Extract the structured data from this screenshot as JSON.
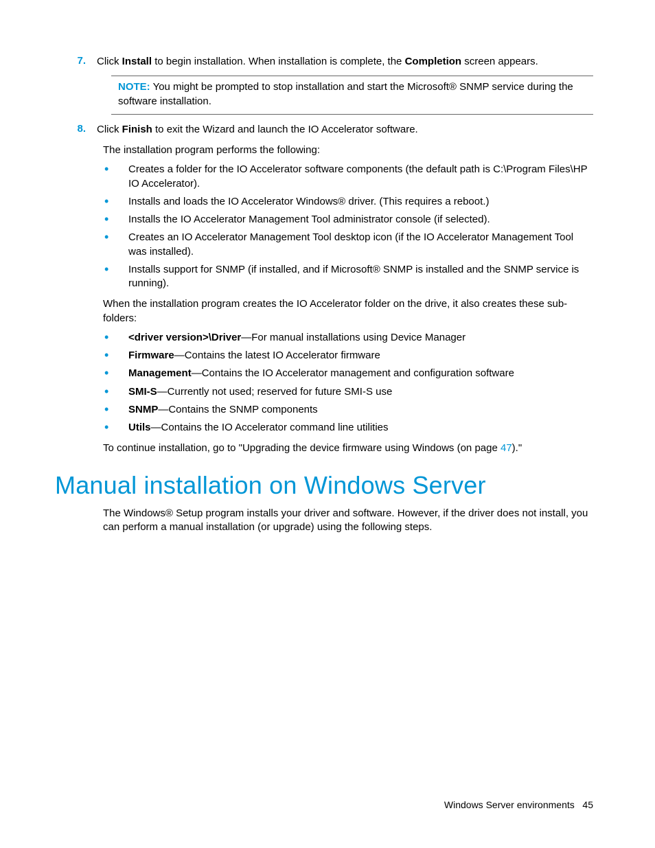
{
  "steps": [
    {
      "num": "7.",
      "pre": "Click ",
      "bold1": "Install",
      "mid": " to begin installation. When installation is complete, the ",
      "bold2": "Completion",
      "post": " screen appears."
    },
    {
      "num": "8.",
      "pre": "Click ",
      "bold1": "Finish",
      "mid": " to exit the Wizard and launch the IO Accelerator software.",
      "bold2": "",
      "post": ""
    }
  ],
  "note": {
    "label": "NOTE:",
    "text": "  You might be prompted to stop installation and start the Microsoft® SNMP service during the software installation."
  },
  "para1": "The installation program performs the following:",
  "actions": [
    "Creates a folder for the IO Accelerator software components (the default path is C:\\Program Files\\HP IO Accelerator).",
    "Installs and loads the IO Accelerator Windows® driver. (This requires a reboot.)",
    "Installs the IO Accelerator Management Tool administrator console (if selected).",
    "Creates an IO Accelerator Management Tool desktop icon (if the IO Accelerator Management Tool was installed).",
    "Installs support for SNMP (if installed, and if Microsoft® SNMP is installed and the SNMP service is running)."
  ],
  "para2": "When the installation program creates the IO Accelerator folder on the drive, it also creates these sub-folders:",
  "folders": [
    {
      "name": "<driver version>\\Driver",
      "desc": "—For manual installations using Device Manager"
    },
    {
      "name": "Firmware",
      "desc": "—Contains the latest IO Accelerator firmware"
    },
    {
      "name": "Management",
      "desc": "—Contains the IO Accelerator management and configuration software"
    },
    {
      "name": "SMI-S",
      "desc": "—Currently not used; reserved for future SMI-S use"
    },
    {
      "name": "SNMP",
      "desc": "—Contains the SNMP components"
    },
    {
      "name": "Utils",
      "desc": "—Contains the IO Accelerator command line utilities"
    }
  ],
  "continue": {
    "pre": "To continue installation, go to \"Upgrading the device firmware using Windows (on page ",
    "link": "47",
    "post": ").\""
  },
  "heading": "Manual installation on Windows Server",
  "para3": "The Windows® Setup program installs your driver and software. However, if the driver does not install, you can perform a manual installation (or upgrade) using the following steps.",
  "footer": {
    "section": "Windows Server environments",
    "page": "45"
  }
}
